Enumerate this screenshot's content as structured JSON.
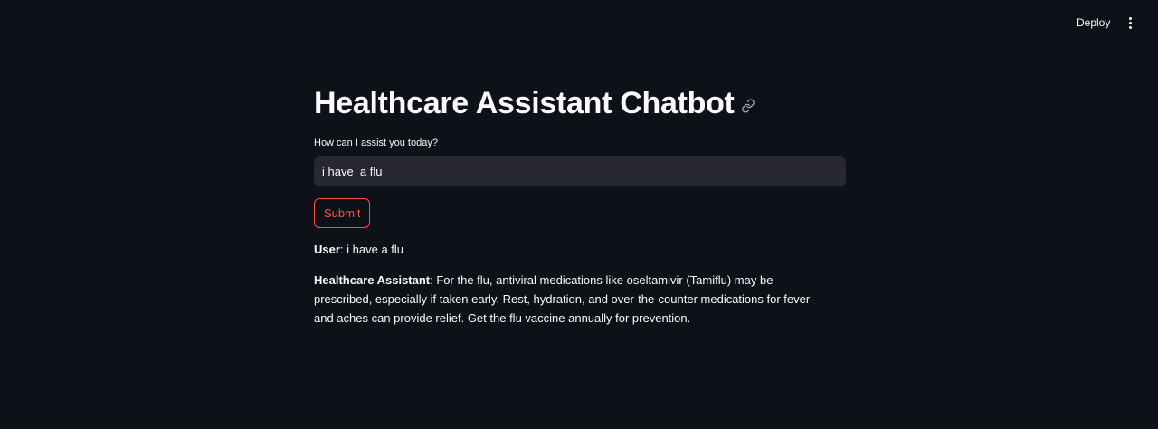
{
  "header": {
    "deploy_label": "Deploy",
    "menu_icon": "vertical-ellipsis-icon"
  },
  "main": {
    "title": "Healthcare Assistant Chatbot",
    "title_icon": "link-icon",
    "input_label": "How can I assist you today?",
    "input_value": "i have  a flu",
    "submit_label": "Submit"
  },
  "chat": {
    "user_speaker": "User",
    "user_message": ": i have a flu",
    "assistant_speaker": "Healthcare Assistant",
    "assistant_message": ": For the flu, antiviral medications like oseltamivir (Tamiflu) may be prescribed, especially if taken early. Rest, hydration, and over-the-counter medications for fever and aches can provide relief. Get the flu vaccine annually for prevention."
  },
  "colors": {
    "background": "#0e1117",
    "input_background": "#262730",
    "accent": "#ff4b4b",
    "text": "#fafafa"
  }
}
